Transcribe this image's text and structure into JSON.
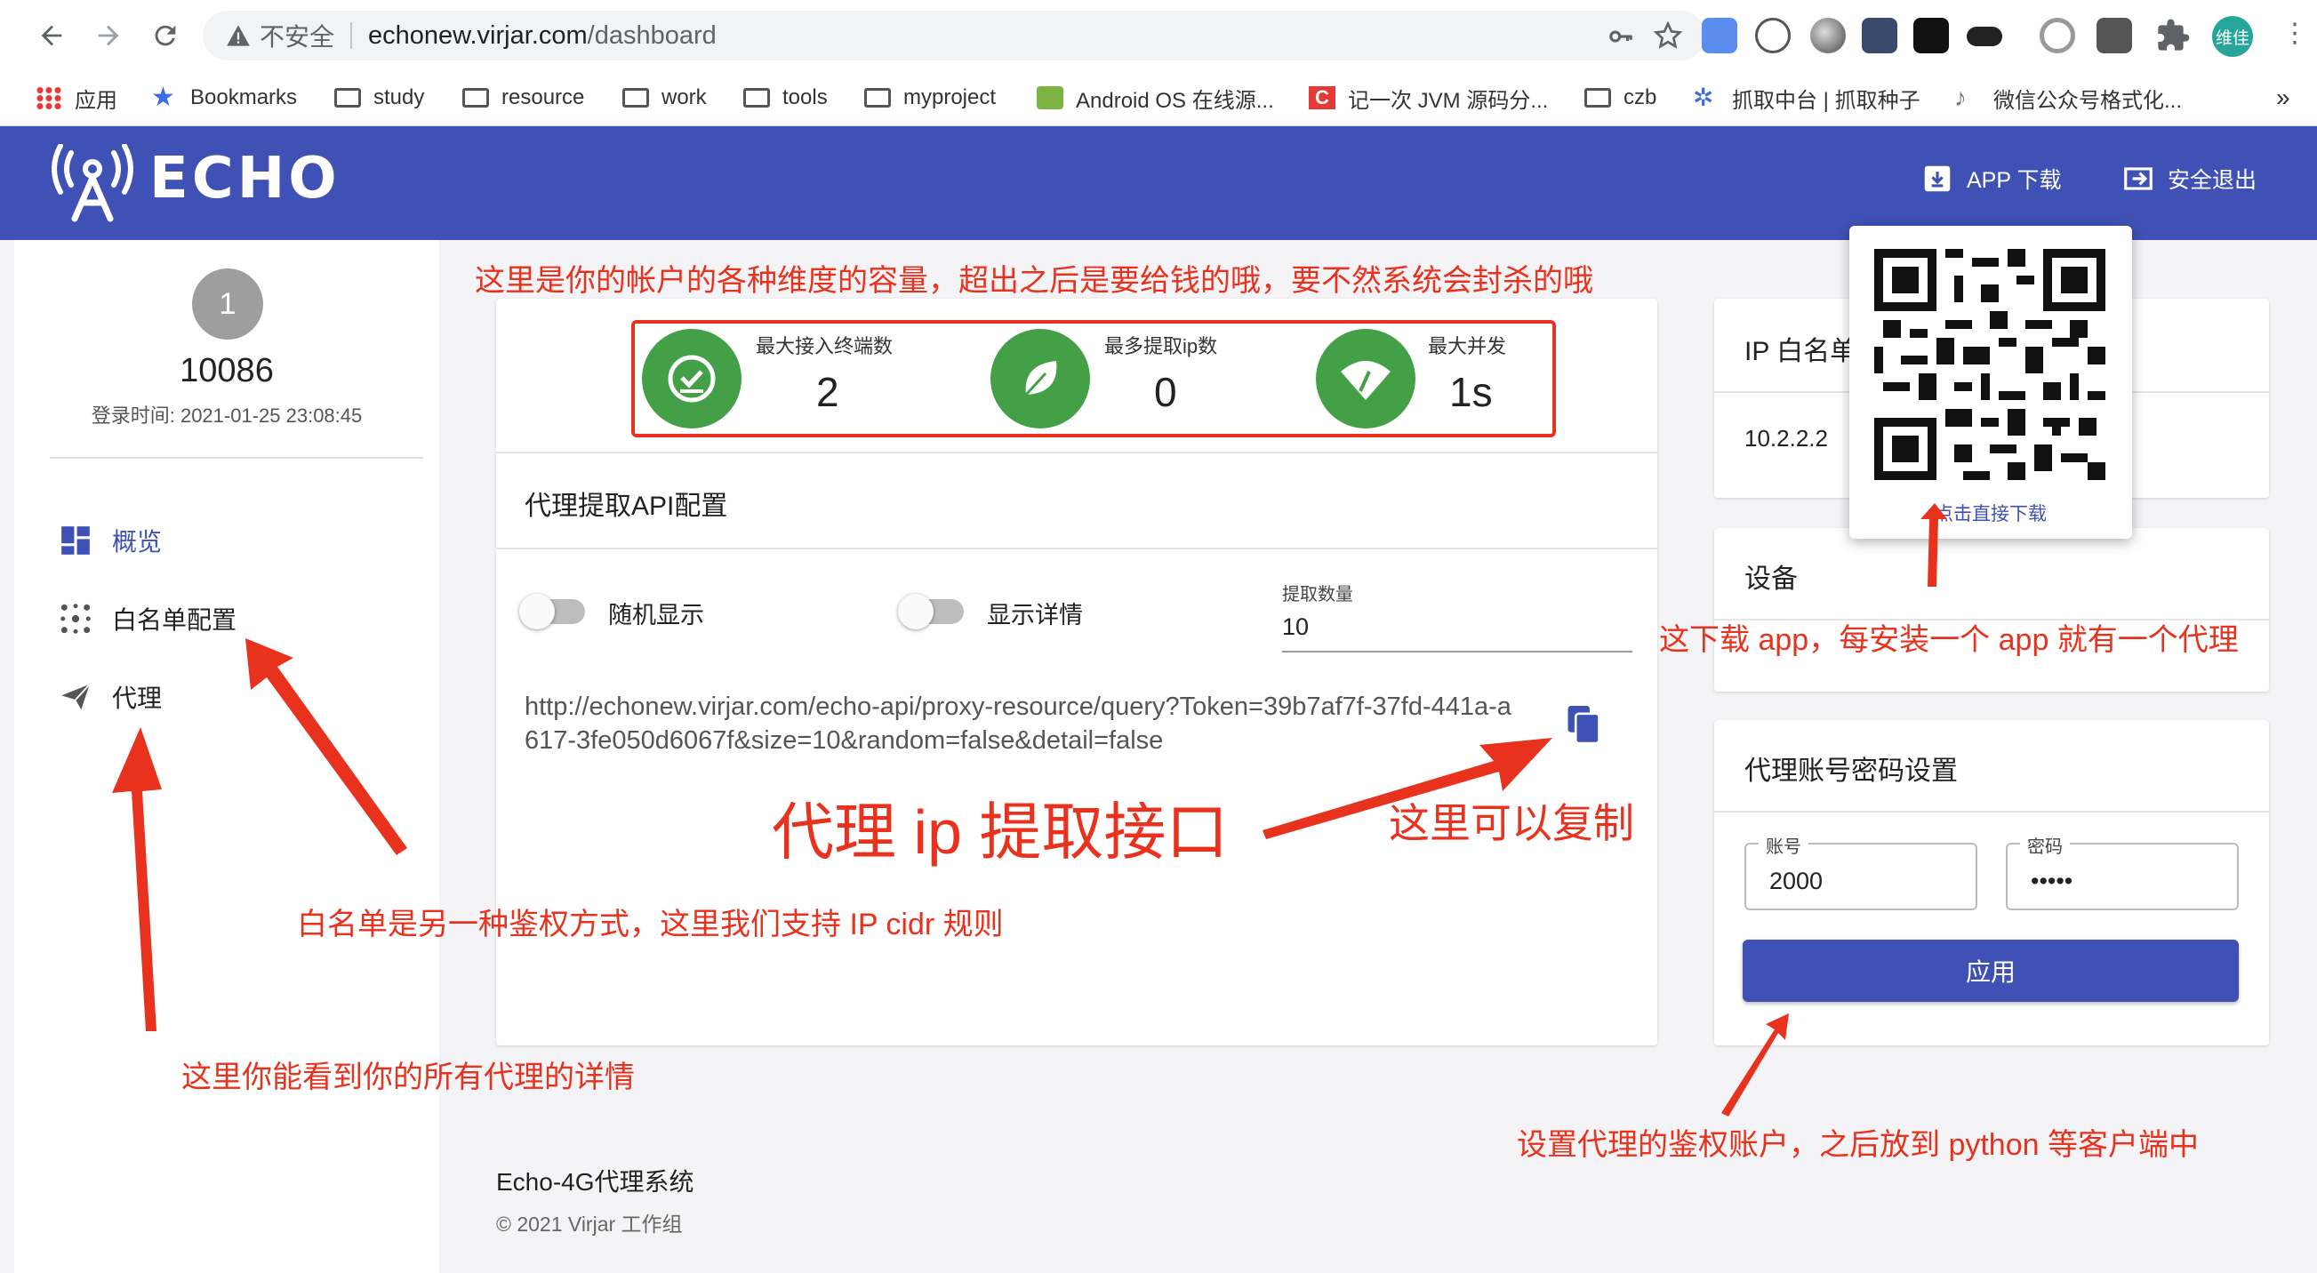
{
  "browser": {
    "insecure_label": "不安全",
    "url_host": "echonew.virjar.com",
    "url_path": "/dashboard",
    "profile_label": "维佳",
    "bookmarks": [
      {
        "label": "应用"
      },
      {
        "label": "Bookmarks"
      },
      {
        "label": "study"
      },
      {
        "label": "resource"
      },
      {
        "label": "work"
      },
      {
        "label": "tools"
      },
      {
        "label": "myproject"
      },
      {
        "label": "Android OS 在线源..."
      },
      {
        "label": "记一次 JVM 源码分..."
      },
      {
        "label": "czb"
      },
      {
        "label": "抓取中台 | 抓取种子"
      },
      {
        "label": "微信公众号格式化..."
      }
    ],
    "more_label": "»"
  },
  "header": {
    "logo": "ECHO",
    "app_download": "APP 下载",
    "logout": "安全退出"
  },
  "sidebar": {
    "avatar": "1",
    "user_id": "10086",
    "login_time": "登录时间: 2021-01-25 23:08:45",
    "items": [
      {
        "label": "概览"
      },
      {
        "label": "白名单配置"
      },
      {
        "label": "代理"
      }
    ]
  },
  "stats": [
    {
      "label": "最大接入终端数",
      "value": "2"
    },
    {
      "label": "最多提取ip数",
      "value": "0"
    },
    {
      "label": "最大并发",
      "value": "1s"
    }
  ],
  "api_config": {
    "title": "代理提取API配置",
    "random_label": "随机显示",
    "detail_label": "显示详情",
    "count_label": "提取数量",
    "count_value": "10",
    "url": "http://echonew.virjar.com/echo-api/proxy-resource/query?Token=39b7af7f-37fd-441a-a617-3fe050d6067f&size=10&random=false&detail=false"
  },
  "whitelist": {
    "title": "IP 白名单",
    "ip": "10.2.2.2"
  },
  "device": {
    "title": "设备"
  },
  "qr": {
    "caption": "点击直接下载"
  },
  "proxy_account": {
    "title": "代理账号密码设置",
    "account_label": "账号",
    "account_value": "2000",
    "password_label": "密码",
    "password_value": "•••••",
    "apply_label": "应用"
  },
  "footer": {
    "name": "Echo-4G代理系统",
    "copyright": "© 2021 Virjar 工作组"
  },
  "annotations": {
    "capacity": "这里是你的帐户的各种维度的容量，超出之后是要给钱的哦，要不然系统会封杀的哦",
    "api": "代理 ip 提取接口",
    "copy": "这里可以复制",
    "whitelist": "白名单是另一种鉴权方式，这里我们支持 IP cidr 规则",
    "proxy": "这里你能看到你的所有代理的详情",
    "app": "这下载 app，每安装一个 app 就有一个代理",
    "account": "设置代理的鉴权账户，之后放到 python 等客户端中"
  },
  "colors": {
    "primary": "#3f51b5",
    "green": "#43a047",
    "annotation": "#e8321e"
  }
}
